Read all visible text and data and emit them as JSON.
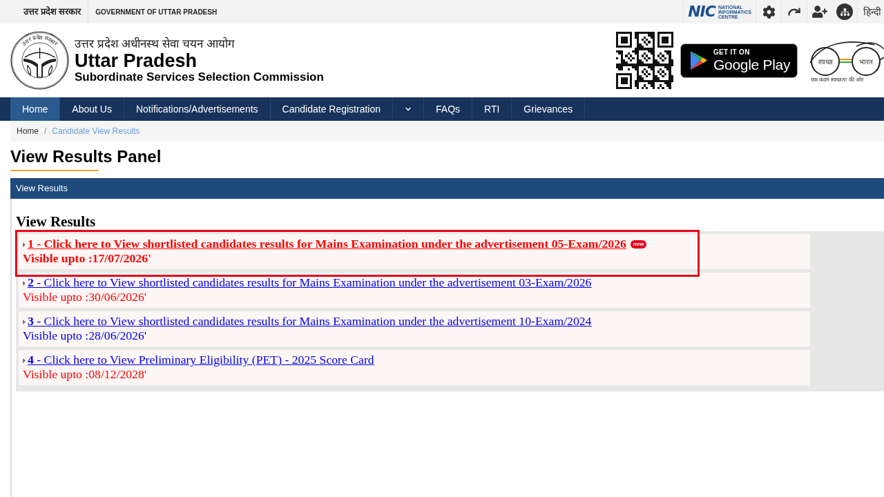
{
  "top_bar": {
    "state_name": "उत्तर प्रदेश सरकार",
    "government": "GOVERNMENT OF UTTAR PRADESH",
    "nic_logo": {
      "mark": "NIC",
      "lines": [
        "NATIONAL",
        "INFORMATICS",
        "CENTRE"
      ]
    },
    "language": "हिन्दी"
  },
  "header": {
    "emblem_text": "उत्तर प्रदेश सरकार",
    "hindi_title": "उत्तर प्रदेश अधीनस्थ सेवा चयन आयोग",
    "title": "Uttar Pradesh",
    "subtitle": "Subordinate Services Selection Commission",
    "play_badge": {
      "small": "GET IT ON",
      "large": "Google Play"
    },
    "swachh_bharat": {
      "left": "स्वच्छ",
      "right": "भारत",
      "tagline": "एक कदम स्वच्छता की ओर"
    }
  },
  "nav": {
    "items": [
      {
        "kind": "link",
        "label": "Home",
        "selected": true
      },
      {
        "kind": "link",
        "label": "About Us",
        "selected": false
      },
      {
        "kind": "link",
        "label": "Notifications/Advertisements",
        "selected": false
      },
      {
        "kind": "link",
        "label": "Candidate Registration",
        "selected": false
      },
      {
        "kind": "toggle",
        "selected": false
      },
      {
        "kind": "link",
        "label": "FAQs",
        "selected": false
      },
      {
        "kind": "link",
        "label": "RTI",
        "selected": false
      },
      {
        "kind": "link",
        "label": "Grievances",
        "selected": false
      }
    ]
  },
  "breadcrumb": {
    "separator": "/",
    "items": [
      {
        "label": "Home",
        "current": false
      },
      {
        "label": "Candidate View Results",
        "current": true
      }
    ]
  },
  "page_title": "View Results Panel",
  "panel": {
    "header": "View Results",
    "heading": "View Results",
    "results": [
      {
        "link": {
          "text": "**1** - Click here to View shortlisted candidates results for Mains Examination under the advertisement 05-Exam/2026",
          "color": "#ff0000"
        },
        "bold": true,
        "badge": "new",
        "visible": {
          "text": "Visible upto :17/07/2026'",
          "color": "#ff0000"
        },
        "highlighted": true
      },
      {
        "link": {
          "text": "**2** - Click here to View shortlisted candidates results for Mains Examination under the advertisement 03-Exam/2026",
          "color": "#0000ee"
        },
        "bold": false,
        "visible": {
          "text": "Visible upto :30/06/2026'",
          "color": "#ff0000"
        },
        "highlighted": false
      },
      {
        "link": {
          "text": "**3** - Click here to View shortlisted candidates results for Mains Examination under the advertisement 10-Exam/2024",
          "color": "#0000ee"
        },
        "bold": false,
        "visible": {
          "text": "Visible upto :28/06/2026'",
          "color": "#0000ee"
        },
        "highlighted": false
      },
      {
        "link": {
          "text": "**4** - Click here to View Preliminary Eligibility (PET) - 2025 Score Card",
          "color": "#0000ee"
        },
        "bold": false,
        "visible": {
          "text": "Visible upto :08/12/2028'",
          "color": "#ff0000"
        },
        "highlighted": false
      }
    ]
  }
}
